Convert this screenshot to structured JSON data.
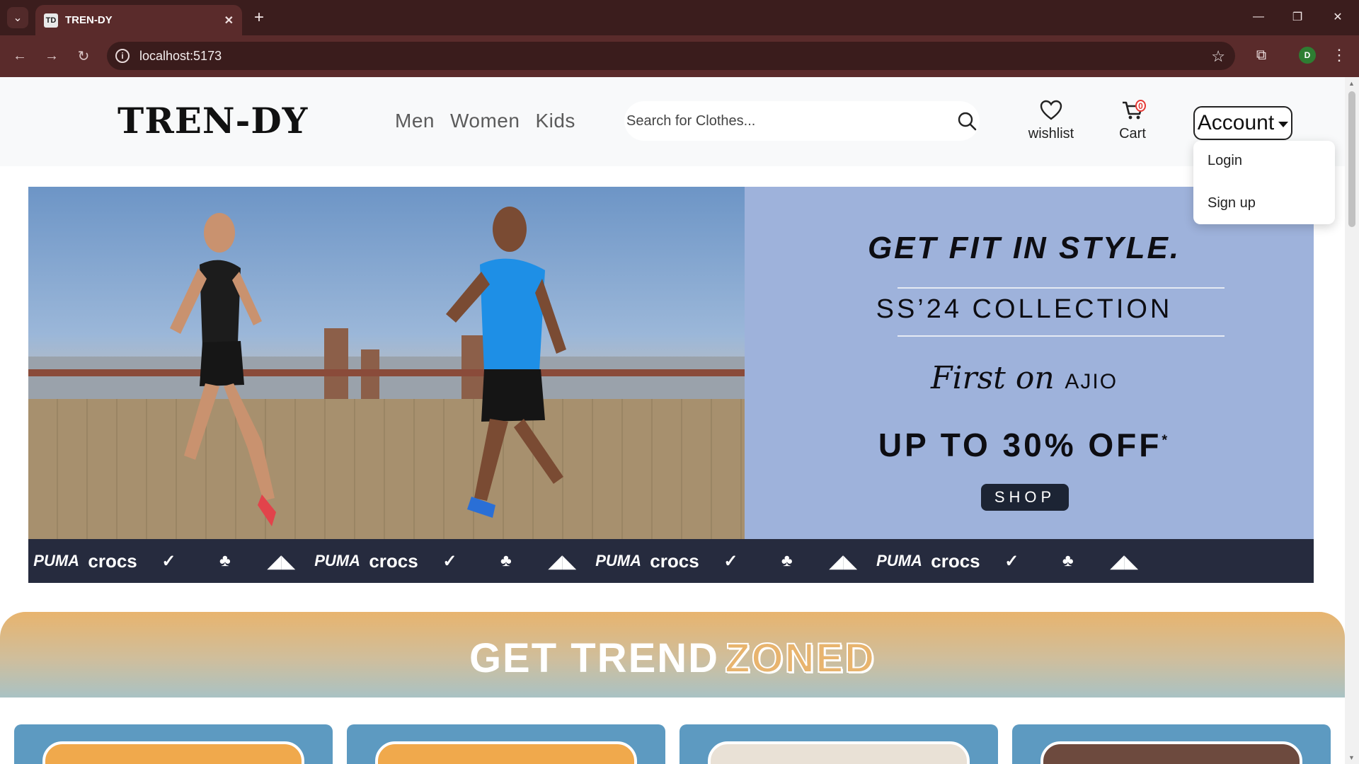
{
  "browser": {
    "tab_title": "TREN-DY",
    "tab_favicon": "TD",
    "url": "localhost:5173",
    "profile_initial": "D",
    "icons": [
      "tab-list-icon",
      "close-icon",
      "new-tab-icon",
      "minimize-icon",
      "restore-icon",
      "window-close-icon",
      "back-icon",
      "forward-icon",
      "reload-icon",
      "info-icon",
      "star-icon",
      "extensions-icon",
      "more-icon"
    ]
  },
  "header": {
    "logo_text": "TREN-DY",
    "nav": [
      "Men",
      "Women",
      "Kids"
    ],
    "search_placeholder": "Search for Clothes...",
    "wishlist_label": "wishlist",
    "cart_label": "Cart",
    "cart_count": "0",
    "account_label": "Account"
  },
  "account_menu": {
    "login": "Login",
    "signup": "Sign up"
  },
  "banner": {
    "headline": "GET FIT IN STYLE.",
    "collection": "SS’24 COLLECTION",
    "first_on_script": "First on",
    "first_on_brand": "AJIO",
    "offer": "UP TO 30% OFF",
    "offer_mark": "*",
    "shop_label": "SHOP",
    "brands": [
      "PUMA",
      "crocs",
      "nike",
      "adidas-originals",
      "adidas",
      "PUMA",
      "crocs",
      "nike",
      "adidas-originals",
      "adidas",
      "PUMA",
      "crocs",
      "nike",
      "adidas-originals",
      "adidas",
      "PUMA",
      "crocs",
      "nike",
      "adidas-originals",
      "adidas"
    ],
    "brand_puma": "PUMA",
    "brand_crocs": "crocs"
  },
  "trend": {
    "title_main": "GET TREND",
    "title_accent": "ZONED"
  },
  "colors": {
    "browser_frame": "#3b1d1d",
    "toolbar": "#5a2b2b",
    "promo_bg": "#9eb2db",
    "brand_strip": "#262b3e",
    "trend_top": "#e8b46e",
    "card_bg": "#5d9ac1"
  }
}
